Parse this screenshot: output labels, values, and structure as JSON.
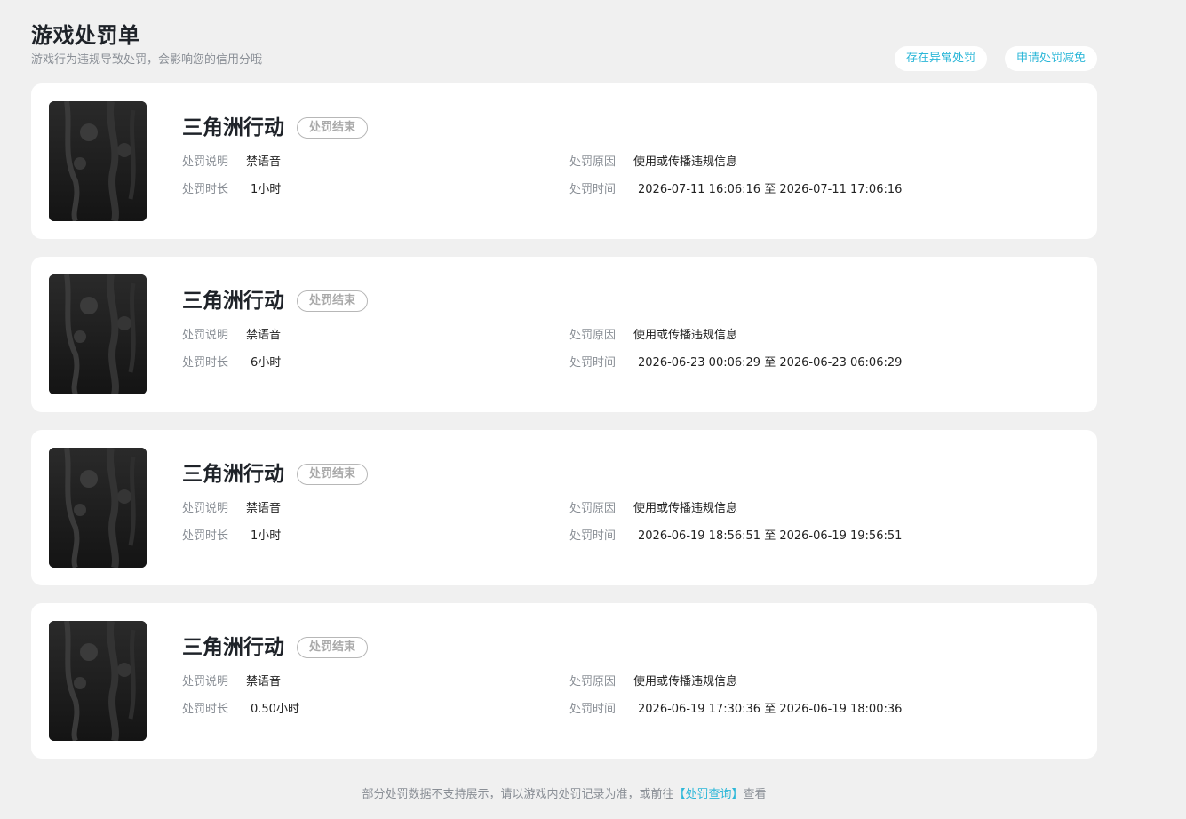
{
  "header": {
    "title": "游戏处罚单",
    "subtitle": "游戏行为违规导致处罚，会影响您的信用分哦",
    "actions": [
      {
        "label": "存在异常处罚"
      },
      {
        "label": "申请处罚减免"
      }
    ]
  },
  "labels": {
    "description": "处罚说明",
    "duration": "处罚时长",
    "reason": "处罚原因",
    "time": "处罚时间"
  },
  "records": [
    {
      "game": "三角洲行动",
      "status": "处罚结束",
      "description": "禁语音",
      "duration": "1小时",
      "reason": "使用或传播违规信息",
      "time": "2026-07-11 16:06:16 至 2026-07-11 17:06:16"
    },
    {
      "game": "三角洲行动",
      "status": "处罚结束",
      "description": "禁语音",
      "duration": "6小时",
      "reason": "使用或传播违规信息",
      "time": "2026-06-23 00:06:29 至 2026-06-23 06:06:29"
    },
    {
      "game": "三角洲行动",
      "status": "处罚结束",
      "description": "禁语音",
      "duration": "1小时",
      "reason": "使用或传播违规信息",
      "time": "2026-06-19 18:56:51 至 2026-06-19 19:56:51"
    },
    {
      "game": "三角洲行动",
      "status": "处罚结束",
      "description": "禁语音",
      "duration": "0.50小时",
      "reason": "使用或传播违规信息",
      "time": "2026-06-19 17:30:36 至 2026-06-19 18:00:36"
    }
  ],
  "footer": {
    "text_before": "部分处罚数据不支持展示，请以游戏内处罚记录为准，或前往",
    "link": "【处罚查询】",
    "text_after": "查看"
  },
  "colors": {
    "accent": "#2cb7d8",
    "background": "#f0f0f0",
    "card": "#ffffff"
  }
}
